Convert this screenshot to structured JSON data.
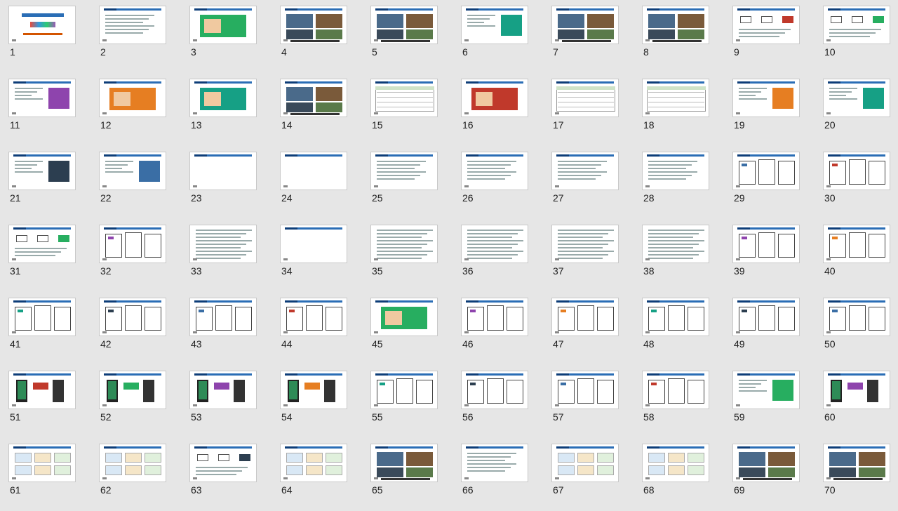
{
  "slide_sorter": {
    "slides": [
      {
        "number": "1",
        "kind": "title"
      },
      {
        "number": "2",
        "kind": "text"
      },
      {
        "number": "3",
        "kind": "image"
      },
      {
        "number": "4",
        "kind": "photos"
      },
      {
        "number": "5",
        "kind": "photos"
      },
      {
        "number": "6",
        "kind": "mixed"
      },
      {
        "number": "7",
        "kind": "photos"
      },
      {
        "number": "8",
        "kind": "photos"
      },
      {
        "number": "9",
        "kind": "diagram"
      },
      {
        "number": "10",
        "kind": "diagram"
      },
      {
        "number": "11",
        "kind": "mixed"
      },
      {
        "number": "12",
        "kind": "image"
      },
      {
        "number": "13",
        "kind": "image"
      },
      {
        "number": "14",
        "kind": "photos"
      },
      {
        "number": "15",
        "kind": "table"
      },
      {
        "number": "16",
        "kind": "image"
      },
      {
        "number": "17",
        "kind": "table"
      },
      {
        "number": "18",
        "kind": "table"
      },
      {
        "number": "19",
        "kind": "mixed"
      },
      {
        "number": "20",
        "kind": "mixed"
      },
      {
        "number": "21",
        "kind": "mixed"
      },
      {
        "number": "22",
        "kind": "mixed"
      },
      {
        "number": "23",
        "kind": "blank"
      },
      {
        "number": "24",
        "kind": "blank"
      },
      {
        "number": "25",
        "kind": "text"
      },
      {
        "number": "26",
        "kind": "text"
      },
      {
        "number": "27",
        "kind": "text"
      },
      {
        "number": "28",
        "kind": "text"
      },
      {
        "number": "29",
        "kind": "docs"
      },
      {
        "number": "30",
        "kind": "docs"
      },
      {
        "number": "31",
        "kind": "diagram"
      },
      {
        "number": "32",
        "kind": "docs"
      },
      {
        "number": "33",
        "kind": "dense"
      },
      {
        "number": "34",
        "kind": "blank"
      },
      {
        "number": "35",
        "kind": "dense"
      },
      {
        "number": "36",
        "kind": "dense"
      },
      {
        "number": "37",
        "kind": "dense"
      },
      {
        "number": "38",
        "kind": "dense"
      },
      {
        "number": "39",
        "kind": "docs"
      },
      {
        "number": "40",
        "kind": "docs"
      },
      {
        "number": "41",
        "kind": "docs"
      },
      {
        "number": "42",
        "kind": "docs"
      },
      {
        "number": "43",
        "kind": "docs"
      },
      {
        "number": "44",
        "kind": "docs"
      },
      {
        "number": "45",
        "kind": "image"
      },
      {
        "number": "46",
        "kind": "docs"
      },
      {
        "number": "47",
        "kind": "docs"
      },
      {
        "number": "48",
        "kind": "docs"
      },
      {
        "number": "49",
        "kind": "docs"
      },
      {
        "number": "50",
        "kind": "docs"
      },
      {
        "number": "51",
        "kind": "phones"
      },
      {
        "number": "52",
        "kind": "phones"
      },
      {
        "number": "53",
        "kind": "phones"
      },
      {
        "number": "54",
        "kind": "phones"
      },
      {
        "number": "55",
        "kind": "docs"
      },
      {
        "number": "56",
        "kind": "docs"
      },
      {
        "number": "57",
        "kind": "docs"
      },
      {
        "number": "58",
        "kind": "docs"
      },
      {
        "number": "59",
        "kind": "mixed"
      },
      {
        "number": "60",
        "kind": "phones"
      },
      {
        "number": "61",
        "kind": "cards"
      },
      {
        "number": "62",
        "kind": "cards"
      },
      {
        "number": "63",
        "kind": "diagram"
      },
      {
        "number": "64",
        "kind": "cards"
      },
      {
        "number": "65",
        "kind": "photos"
      },
      {
        "number": "66",
        "kind": "text"
      },
      {
        "number": "67",
        "kind": "cards"
      },
      {
        "number": "68",
        "kind": "cards"
      },
      {
        "number": "69",
        "kind": "photos"
      },
      {
        "number": "70",
        "kind": "photos"
      }
    ]
  },
  "colors": {
    "background": "#e6e6e6",
    "header_bar": "#2a6db5",
    "thumb_border": "#c8c8c8"
  }
}
